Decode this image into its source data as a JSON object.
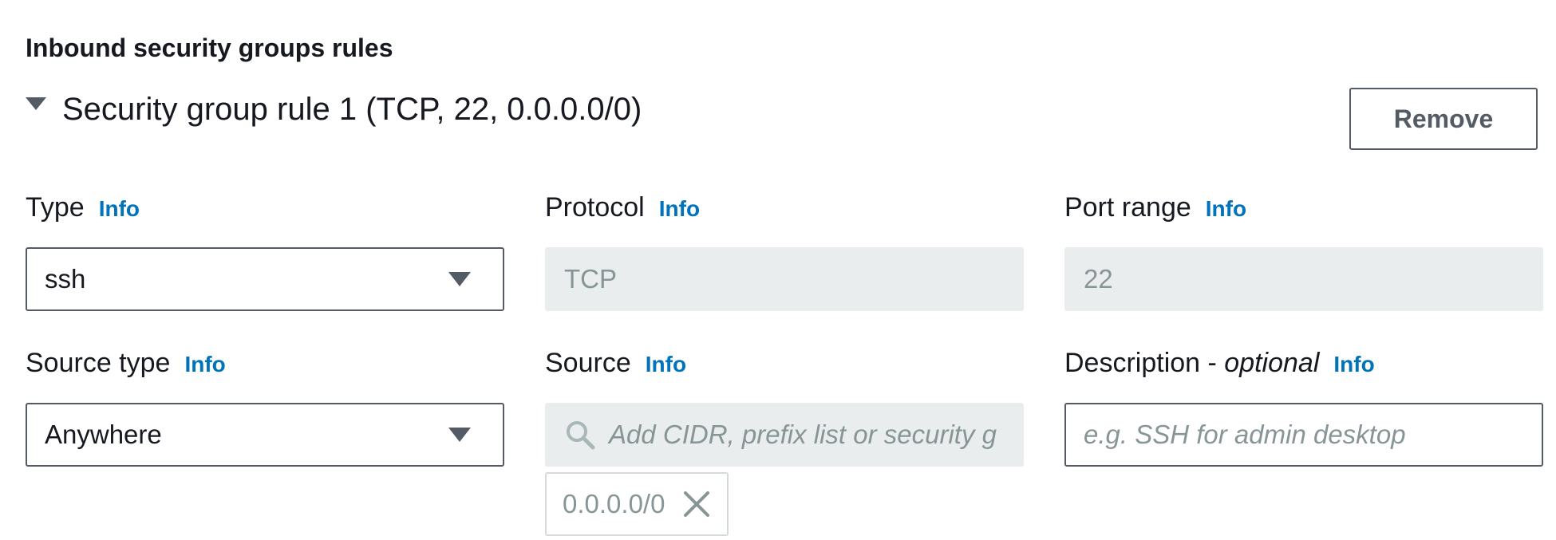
{
  "section": {
    "title": "Inbound security groups rules"
  },
  "rule": {
    "title": "Security group rule 1 (TCP, 22, 0.0.0.0/0)",
    "remove_label": "Remove"
  },
  "info_label": "Info",
  "fields": {
    "type": {
      "label": "Type",
      "value": "ssh"
    },
    "protocol": {
      "label": "Protocol",
      "value": "TCP"
    },
    "port_range": {
      "label": "Port range",
      "value": "22"
    },
    "source_type": {
      "label": "Source type",
      "value": "Anywhere"
    },
    "source": {
      "label": "Source",
      "placeholder": "Add CIDR, prefix list or security g",
      "token": "0.0.0.0/0"
    },
    "description": {
      "label_prefix": "Description - ",
      "label_optional": "optional",
      "placeholder": "e.g. SSH for admin desktop"
    }
  },
  "colors": {
    "info_link": "#0073bb",
    "text": "#16191f",
    "border": "#545b64",
    "disabled_bg": "#eaeded",
    "disabled_text": "#879596"
  },
  "icons": {
    "expand": "caret-down-icon",
    "dropdown": "caret-down-icon",
    "search": "search-icon",
    "close": "close-icon"
  }
}
